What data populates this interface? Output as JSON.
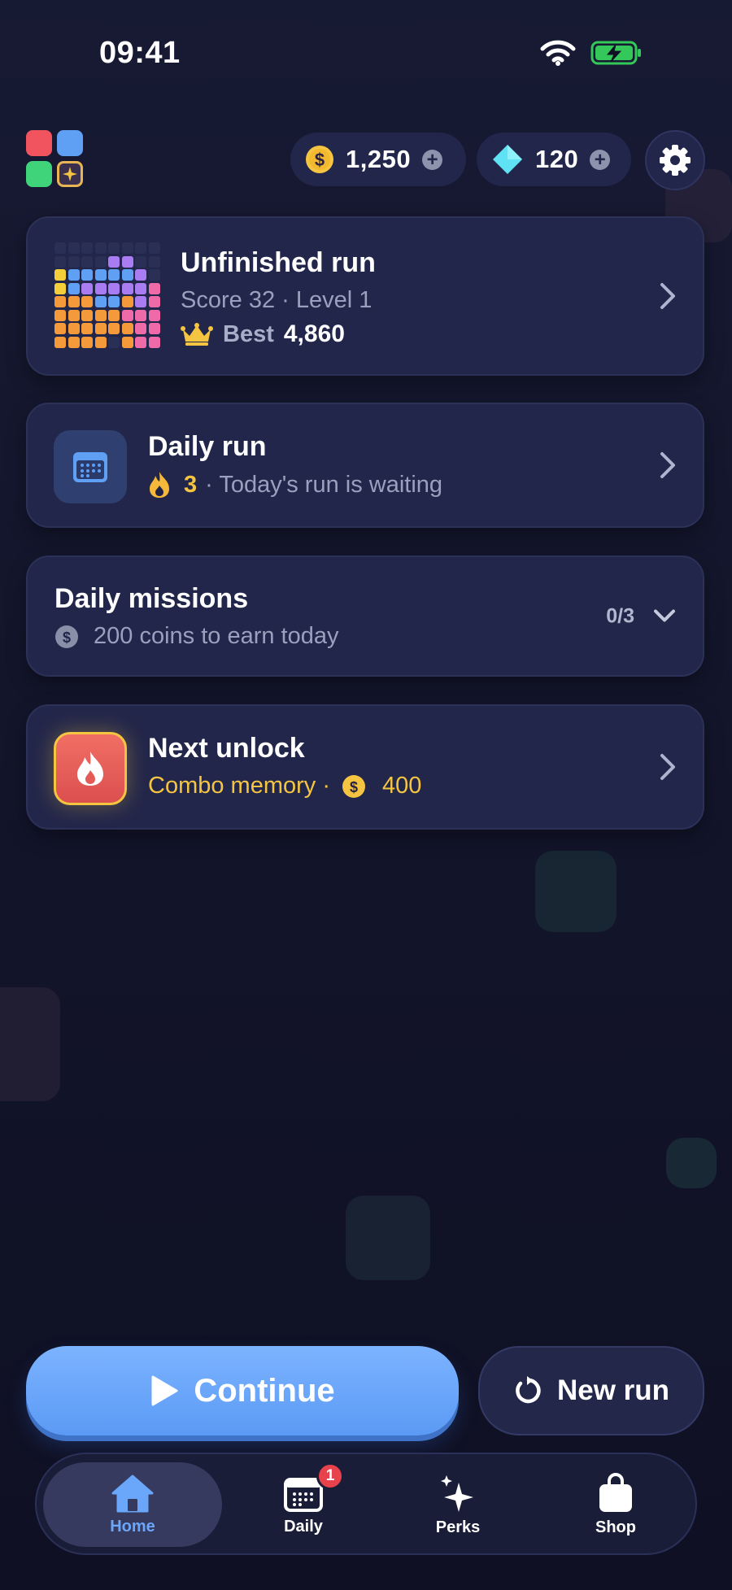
{
  "status_bar": {
    "time": "09:41"
  },
  "currency": {
    "coins": "1,250",
    "gems": "120"
  },
  "unfinished_run": {
    "title": "Unfinished run",
    "detail": "Score 32 · Level 1",
    "best_label": "Best",
    "best_value": "4,860"
  },
  "daily_run": {
    "title": "Daily run",
    "streak": "3",
    "detail": "· Today's run is waiting"
  },
  "daily_missions": {
    "title": "Daily missions",
    "detail": "200 coins to earn today",
    "progress": "0/3"
  },
  "next_unlock": {
    "title": "Next unlock",
    "item": "Combo memory ·",
    "cost": "400"
  },
  "actions": {
    "continue_label": "Continue",
    "new_run_label": "New run"
  },
  "nav": {
    "items": [
      {
        "label": "Home",
        "icon": "home-icon",
        "active": true
      },
      {
        "label": "Daily",
        "icon": "calendar-icon",
        "badge": "1"
      },
      {
        "label": "Perks",
        "icon": "sparkle-icon"
      },
      {
        "label": "Shop",
        "icon": "shopping-bag-icon"
      }
    ]
  },
  "colors": {
    "background": "#13152b",
    "card": "#22264a",
    "accent_blue": "#6aa6fa",
    "gold": "#f5c542",
    "unlock_red": "#e8605a"
  }
}
